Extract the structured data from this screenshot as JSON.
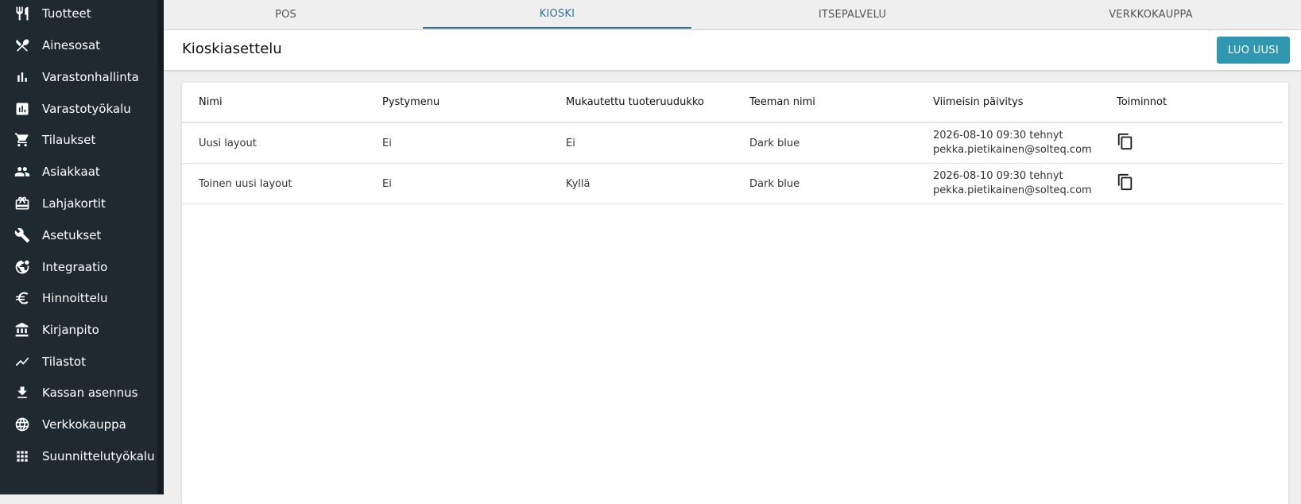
{
  "sidebar": {
    "items": [
      {
        "label": "Tuotteet",
        "icon": "fork-knife-icon"
      },
      {
        "label": "Ainesosat",
        "icon": "crossed-utensils-icon"
      },
      {
        "label": "Varastonhallinta",
        "icon": "bar-chart-icon"
      },
      {
        "label": "Varastotyökalu",
        "icon": "chart-box-icon"
      },
      {
        "label": "Tilaukset",
        "icon": "shopping-cart-icon"
      },
      {
        "label": "Asiakkaat",
        "icon": "people-icon"
      },
      {
        "label": "Lahjakortit",
        "icon": "gift-card-icon"
      },
      {
        "label": "Asetukset",
        "icon": "wrench-icon"
      },
      {
        "label": "Integraatio",
        "icon": "globe-gear-icon"
      },
      {
        "label": "Hinnoittelu",
        "icon": "euro-icon"
      },
      {
        "label": "Kirjanpito",
        "icon": "bank-icon"
      },
      {
        "label": "Tilastot",
        "icon": "trend-line-icon"
      },
      {
        "label": "Kassan asennus",
        "icon": "download-icon"
      },
      {
        "label": "Verkkokauppa",
        "icon": "globe-icon"
      },
      {
        "label": "Suunnittelutyökalu",
        "icon": "grid-icon"
      }
    ]
  },
  "tabs": [
    {
      "label": "POS",
      "active": false
    },
    {
      "label": "KIOSKI",
      "active": true
    },
    {
      "label": "ITSEPALVELU",
      "active": false
    },
    {
      "label": "VERKKOKAUPPA",
      "active": false
    }
  ],
  "header": {
    "title": "Kioskiasettelu",
    "create_label": "LUO UUSI"
  },
  "table": {
    "columns": [
      "Nimi",
      "Pystymenu",
      "Mukautettu tuoteruudukko",
      "Teeman nimi",
      "Viimeisin päivitys",
      "Toiminnot"
    ],
    "rows": [
      {
        "name": "Uusi layout",
        "vertical": "Ei",
        "custom_grid": "Ei",
        "theme": "Dark blue",
        "updated_date": "2026-08-10 09:30 tehnyt",
        "updated_by": "pekka.pietikainen@solteq.com",
        "action_icon": "copy-icon"
      },
      {
        "name": "Toinen uusi layout",
        "vertical": "Ei",
        "custom_grid": "Kyllä",
        "theme": "Dark blue",
        "updated_date": "2026-08-10 09:30 tehnyt",
        "updated_by": "pekka.pietikainen@solteq.com",
        "action_icon": "copy-icon"
      }
    ]
  },
  "colors": {
    "sidebar_bg": "#1f2a30",
    "accent": "#2f97b0",
    "active_tab": "#2e7394"
  }
}
